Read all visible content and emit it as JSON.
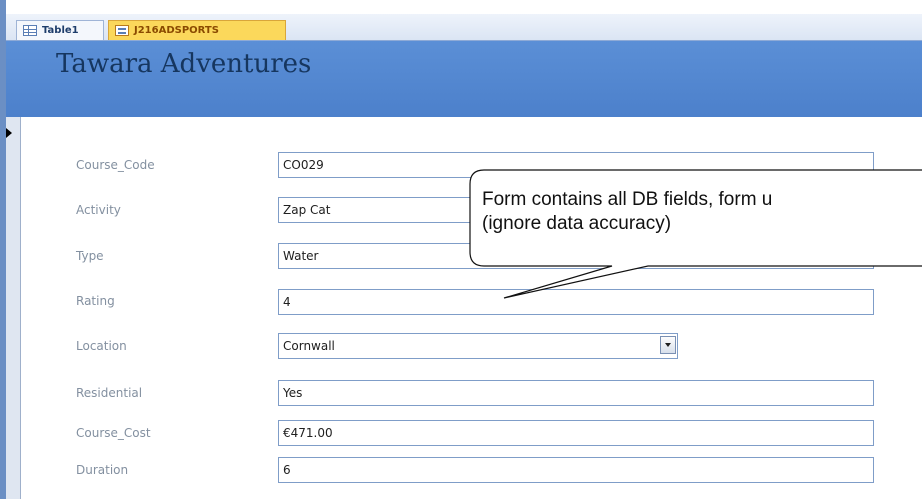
{
  "tabs": [
    {
      "label": "Table1",
      "icon": "table-icon"
    },
    {
      "label": "J216ADSPORTS",
      "icon": "form-icon"
    }
  ],
  "form": {
    "title": "Tawara Adventures",
    "fields": [
      {
        "label": "Course_Code",
        "value": "CO029"
      },
      {
        "label": "Activity",
        "value": "Zap Cat"
      },
      {
        "label": "Type",
        "value": "Water"
      },
      {
        "label": "Rating",
        "value": "4"
      },
      {
        "label": "Location",
        "value": "Cornwall"
      },
      {
        "label": "Residential",
        "value": "Yes"
      },
      {
        "label": "Course_Cost",
        "value": "€471.00"
      },
      {
        "label": "Duration",
        "value": "6"
      }
    ]
  },
  "callout": {
    "line1": "Form contains all DB fields, form u",
    "line2": "(ignore data accuracy)"
  },
  "colors": {
    "header": "#4c80cb",
    "active_tab": "#fbd85b",
    "field_border": "#7f9dc8",
    "label": "#8390a0"
  }
}
